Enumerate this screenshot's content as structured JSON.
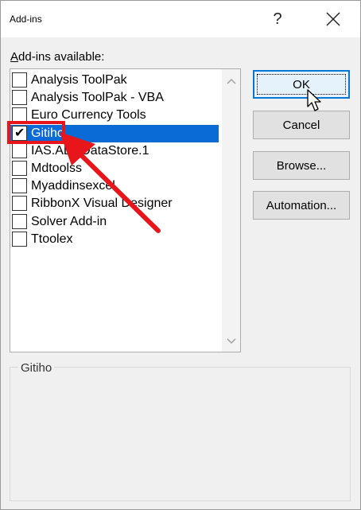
{
  "window": {
    "title": "Add-ins",
    "help_glyph": "?"
  },
  "list": {
    "label_mnemonic": "A",
    "label_rest": "dd-ins available:",
    "items": [
      {
        "label": "Analysis ToolPak",
        "checked": false,
        "selected": false
      },
      {
        "label": "Analysis ToolPak - VBA",
        "checked": false,
        "selected": false
      },
      {
        "label": "Euro Currency Tools",
        "checked": false,
        "selected": false
      },
      {
        "label": "Gitiho",
        "checked": true,
        "selected": true
      },
      {
        "label": "IAS.ADSDataStore.1",
        "checked": false,
        "selected": false
      },
      {
        "label": "Mdtoolss",
        "checked": false,
        "selected": false
      },
      {
        "label": "Myaddinsexcel",
        "checked": false,
        "selected": false
      },
      {
        "label": "RibbonX Visual Designer",
        "checked": false,
        "selected": false
      },
      {
        "label": "Solver Add-in",
        "checked": false,
        "selected": false
      },
      {
        "label": "Ttoolex",
        "checked": false,
        "selected": false
      }
    ]
  },
  "buttons": {
    "ok": "OK",
    "cancel": "Cancel",
    "browse": "Browse...",
    "automation": "Automation..."
  },
  "description": {
    "title": "Gitiho"
  },
  "colors": {
    "selection": "#0a6ad6",
    "annotation": "#e8151b",
    "default_button_border": "#0078d7"
  }
}
